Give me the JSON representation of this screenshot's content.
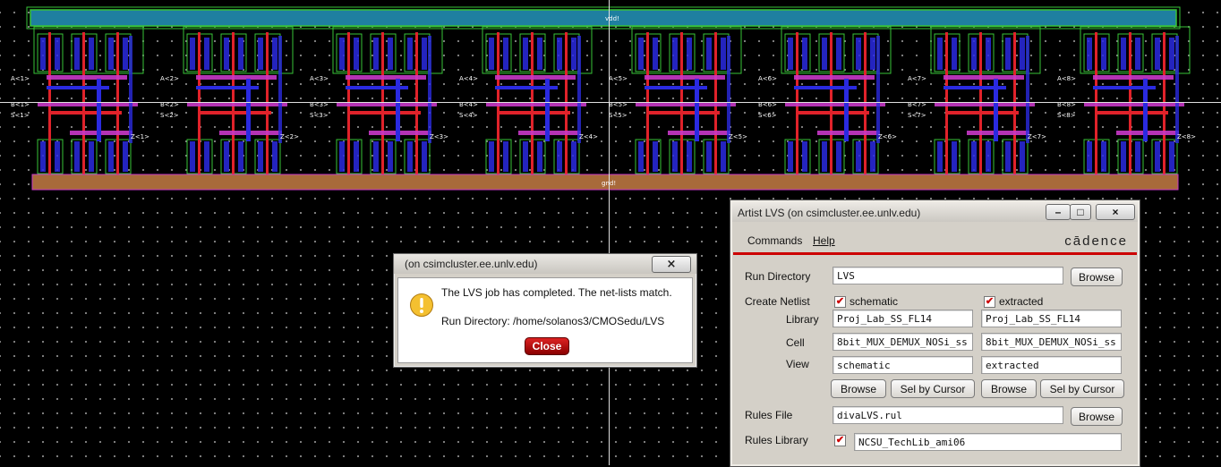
{
  "layout_view": {
    "rail_top_label": "vdd!",
    "rail_bottom_label": "gnd!",
    "cell_labels": [
      {
        "a": "A<1>",
        "b": "B<1>",
        "s": "S<1>",
        "z": "Z<1>"
      },
      {
        "a": "A<2>",
        "b": "B<2>",
        "s": "S<2>",
        "z": "Z<2>"
      },
      {
        "a": "A<3>",
        "b": "B<3>",
        "s": "S<3>",
        "z": "Z<3>"
      },
      {
        "a": "A<4>",
        "b": "B<4>",
        "s": "S<4>",
        "z": "Z<4>"
      },
      {
        "a": "A<5>",
        "b": "B<5>",
        "s": "S<5>",
        "z": "Z<5>"
      },
      {
        "a": "A<6>",
        "b": "B<6>",
        "s": "S<6>",
        "z": "Z<6>"
      },
      {
        "a": "A<7>",
        "b": "B<7>",
        "s": "S<7>",
        "z": "Z<7>"
      },
      {
        "a": "A<8>",
        "b": "B<8>",
        "s": "S<8>",
        "z": "Z<8>"
      }
    ],
    "colors": {
      "vdd_rail": "#1f7fa0",
      "gnd_rail": "#a86a3a",
      "nwell_outline": "#39c439",
      "metal1": "#2a2ae0",
      "poly": "#e0222a",
      "select": "#c838c8"
    }
  },
  "popup": {
    "title": "(on csimcluster.ee.unlv.edu)",
    "close_x": "×",
    "message": "The LVS job has completed. The net-lists match.",
    "run_directory": "Run Directory: /home/solanos3/CMOSedu/LVS",
    "close_button": "Close"
  },
  "lvs_window": {
    "title": "Artist LVS (on csimcluster.ee.unlv.edu)",
    "menu": {
      "commands": "Commands",
      "help": "Help"
    },
    "brand": "cādence",
    "run_directory_label": "Run Directory",
    "run_directory_value": "LVS",
    "browse": "Browse",
    "create_netlist_label": "Create Netlist",
    "schematic_label": "schematic",
    "extracted_label": "extracted",
    "library_label": "Library",
    "cell_label": "Cell",
    "view_label": "View",
    "schematic_library": "Proj_Lab_SS_FL14",
    "extracted_library": "Proj_Lab_SS_FL14",
    "schematic_cell": "8bit_MUX_DEMUX_NOSi_ss",
    "extracted_cell": "8bit_MUX_DEMUX_NOSi_ss",
    "schematic_view": "schematic",
    "extracted_view": "extracted",
    "sel_by_cursor": "Sel by Cursor",
    "rules_file_label": "Rules File",
    "rules_file_value": "divaLVS.rul",
    "rules_library_label": "Rules Library",
    "rules_library_value": "NCSU_TechLib_ami06",
    "schematic_checked": true,
    "extracted_checked": true,
    "rules_library_checked": true,
    "check_mark": "✔"
  }
}
